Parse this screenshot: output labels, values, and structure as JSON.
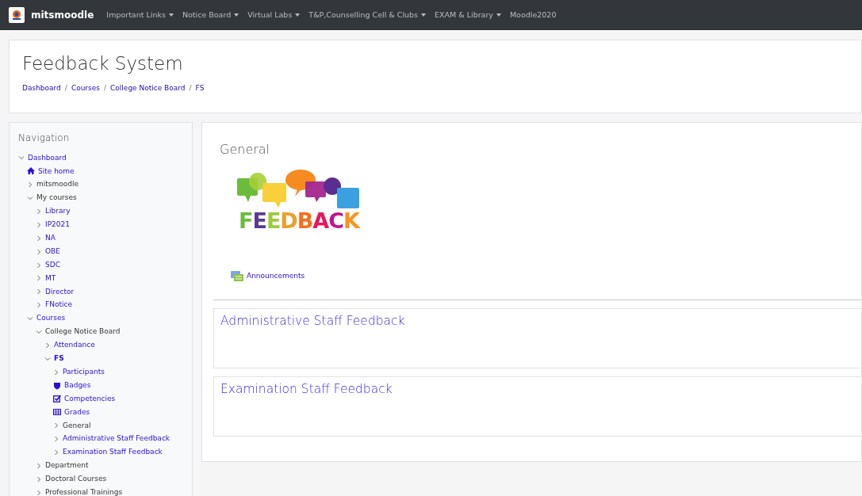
{
  "navbar": {
    "brand": "mitsmoodle",
    "menus": [
      {
        "label": "Important Links",
        "dropdown": true
      },
      {
        "label": "Notice Board",
        "dropdown": true
      },
      {
        "label": "Virtual Labs",
        "dropdown": true
      },
      {
        "label": "T&P,Counselling Cell & Clubs",
        "dropdown": true
      },
      {
        "label": "EXAM & Library",
        "dropdown": true
      },
      {
        "label": "Moodle2020",
        "dropdown": false
      }
    ]
  },
  "header": {
    "title": "Feedback System",
    "separator": "/",
    "breadcrumb": [
      "Dashboard",
      "Courses",
      "College Notice Board",
      "FS"
    ]
  },
  "navigation": {
    "title": "Navigation",
    "items": [
      {
        "label": "Dashboard",
        "link": true,
        "expanded": true,
        "children": [
          {
            "label": "Site home",
            "link": true,
            "kind": "home"
          },
          {
            "label": "mitsmoodle",
            "link": false,
            "expanded": false
          },
          {
            "label": "My courses",
            "link": false,
            "expanded": true,
            "children": [
              {
                "label": "Library",
                "link": true,
                "expanded": false
              },
              {
                "label": "IP2021",
                "link": true,
                "expanded": false
              },
              {
                "label": "NA",
                "link": true,
                "expanded": false
              },
              {
                "label": "OBE",
                "link": true,
                "expanded": false
              },
              {
                "label": "SDC",
                "link": true,
                "expanded": false
              },
              {
                "label": "MT",
                "link": true,
                "expanded": false
              },
              {
                "label": "Director",
                "link": true,
                "expanded": false
              },
              {
                "label": "FNotice",
                "link": true,
                "expanded": false
              }
            ]
          },
          {
            "label": "Courses",
            "link": true,
            "expanded": true,
            "children": [
              {
                "label": "College Notice Board",
                "link": false,
                "expanded": true,
                "children": [
                  {
                    "label": "Attendance",
                    "link": true,
                    "expanded": false
                  },
                  {
                    "label": "FS",
                    "link": true,
                    "expanded": true,
                    "selected": true,
                    "children": [
                      {
                        "label": "Participants",
                        "link": true,
                        "expanded": false
                      },
                      {
                        "label": "Badges",
                        "link": true,
                        "kind": "badges"
                      },
                      {
                        "label": "Competencies",
                        "link": true,
                        "kind": "competencies"
                      },
                      {
                        "label": "Grades",
                        "link": true,
                        "kind": "grades"
                      },
                      {
                        "label": "General",
                        "link": false,
                        "expanded": false
                      },
                      {
                        "label": "Administrative Staff Feedback",
                        "link": true,
                        "expanded": false
                      },
                      {
                        "label": "Examination Staff Feedback",
                        "link": true,
                        "expanded": false
                      }
                    ]
                  }
                ]
              },
              {
                "label": "Department",
                "link": false,
                "expanded": false
              },
              {
                "label": "Doctoral Courses",
                "link": false,
                "expanded": false
              },
              {
                "label": "Professional Trainings",
                "link": false,
                "expanded": false
              }
            ]
          }
        ]
      }
    ]
  },
  "main": {
    "sections": [
      {
        "kind": "general",
        "title": "General",
        "logo_text": "FEEDBACK",
        "activities": [
          {
            "label": "Announcements"
          }
        ]
      },
      {
        "kind": "topic",
        "title": "Administrative Staff Feedback"
      },
      {
        "kind": "topic",
        "title": "Examination Staff Feedback"
      }
    ]
  }
}
